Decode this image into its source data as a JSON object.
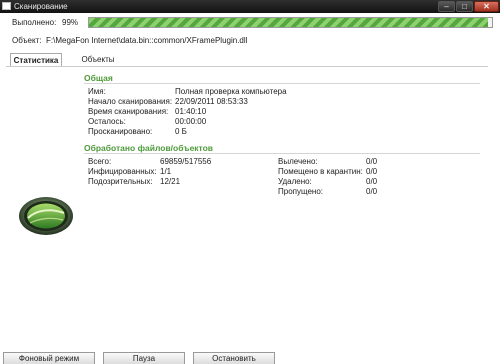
{
  "window": {
    "title": "Сканирование",
    "min_glyph": "–",
    "max_glyph": "□",
    "close_glyph": "✕"
  },
  "progress": {
    "label": "Выполнено:",
    "percent_text": "99%",
    "value": 0.99
  },
  "object": {
    "label": "Объект:",
    "path": "F:\\MegaFon Internet\\data.bin::common/XFramePlugin.dll"
  },
  "tabs": [
    {
      "label": "Статистика"
    },
    {
      "label": "Объекты"
    }
  ],
  "general": {
    "title": "Общая",
    "rows": [
      {
        "label": "Имя:",
        "value": "Полная проверка компьютера"
      },
      {
        "label": "Начало сканирования:",
        "value": "22/09/2011 08:53:33"
      },
      {
        "label": "Время сканирования:",
        "value": "01:40:10"
      },
      {
        "label": "Осталось:",
        "value": "00:00:00"
      },
      {
        "label": "Просканировано:",
        "value": "0 Б"
      }
    ]
  },
  "processed": {
    "title": "Обработано файлов/объектов",
    "left": [
      {
        "label": "Всего:",
        "value": "69859/517556"
      },
      {
        "label": "Инфицированных:",
        "value": "1/1"
      },
      {
        "label": "Подозрительных:",
        "value": "12/21"
      }
    ],
    "right": [
      {
        "label": "Вылечено:",
        "value": "0/0"
      },
      {
        "label": "Помещено в карантин:",
        "value": "0/0"
      },
      {
        "label": "Удалено:",
        "value": "0/0"
      },
      {
        "label": "Пропущено:",
        "value": "0/0"
      }
    ]
  },
  "buttons": {
    "background": "Фоновый режим",
    "pause": "Пауза",
    "stop": "Остановить"
  },
  "colors": {
    "accent": "#4e9a3a",
    "progress_fill": "#6cbf4e"
  },
  "icons": {
    "logo": "green-globe-emblem-icon"
  }
}
